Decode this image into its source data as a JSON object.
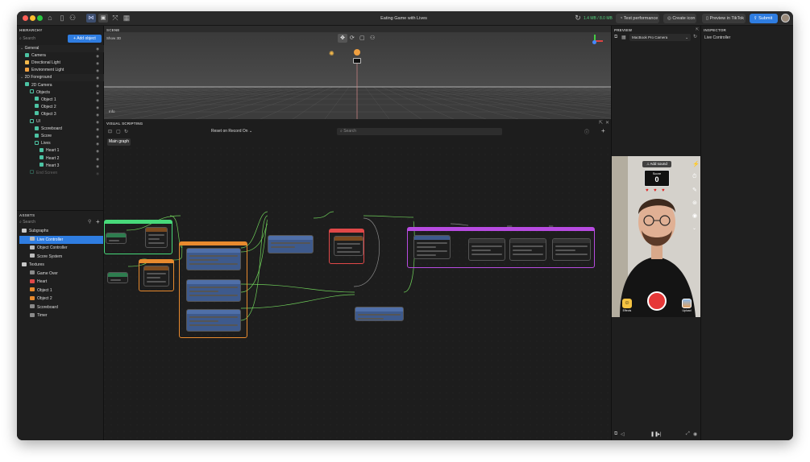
{
  "window": {
    "title": "Eating Game with Lives",
    "memory": "1.4 MB / 8.0 MB",
    "buttons": {
      "test": "Test performance",
      "icon": "Create icon",
      "preview": "Preview in TikTok",
      "submit": "Submit"
    }
  },
  "hierarchy": {
    "title": "HIERARCHY",
    "search_placeholder": "Search",
    "add_button": "+ Add object",
    "rows": [
      {
        "label": "General",
        "indent": 0,
        "section": true,
        "icon": "chevron-down-icon"
      },
      {
        "label": "Camera",
        "indent": 1,
        "icon": "camera-icon"
      },
      {
        "label": "Directional Light",
        "indent": 1,
        "icon": "light-icon"
      },
      {
        "label": "Environment Light",
        "indent": 1,
        "icon": "sun-icon"
      },
      {
        "label": "2D Foreground",
        "indent": 0,
        "section": true,
        "icon": "chevron-down-icon"
      },
      {
        "label": "2D Camera",
        "indent": 1,
        "icon": "camera-icon"
      },
      {
        "label": "Objects",
        "indent": 2,
        "icon": "group-icon"
      },
      {
        "label": "Object 1",
        "indent": 3,
        "icon": "image-icon"
      },
      {
        "label": "Object 2",
        "indent": 3,
        "icon": "image-icon"
      },
      {
        "label": "Object 3",
        "indent": 3,
        "icon": "image-icon"
      },
      {
        "label": "UI",
        "indent": 2,
        "icon": "group-icon"
      },
      {
        "label": "Scoreboard",
        "indent": 3,
        "icon": "image-icon"
      },
      {
        "label": "Score",
        "indent": 3,
        "icon": "text-icon"
      },
      {
        "label": "Lives",
        "indent": 3,
        "icon": "group-icon"
      },
      {
        "label": "Heart 1",
        "indent": 4,
        "icon": "image-icon"
      },
      {
        "label": "Heart 2",
        "indent": 4,
        "icon": "image-icon"
      },
      {
        "label": "Heart 3",
        "indent": 4,
        "icon": "image-icon"
      },
      {
        "label": "End Screen",
        "indent": 2,
        "icon": "group-icon",
        "dim": true
      }
    ]
  },
  "assets": {
    "title": "ASSETS",
    "search_placeholder": "Search",
    "rows": [
      {
        "label": "Subgraphs",
        "indent": 0,
        "icon": "folder-icon"
      },
      {
        "label": "Live Controller",
        "indent": 1,
        "icon": "subgraph-icon",
        "selected": true
      },
      {
        "label": "Object Controller",
        "indent": 1,
        "icon": "subgraph-icon"
      },
      {
        "label": "Score System",
        "indent": 1,
        "icon": "subgraph-icon"
      },
      {
        "label": "Textures",
        "indent": 0,
        "icon": "folder-icon"
      },
      {
        "label": "Game Over",
        "indent": 1,
        "icon": "texture-icon"
      },
      {
        "label": "Heart",
        "indent": 1,
        "icon": "heart-icon"
      },
      {
        "label": "Object 1",
        "indent": 1,
        "icon": "texture-icon"
      },
      {
        "label": "Object 2",
        "indent": 1,
        "icon": "texture-icon"
      },
      {
        "label": "Scoreboard",
        "indent": 1,
        "icon": "texture-icon"
      },
      {
        "label": "Timer",
        "indent": 1,
        "icon": "texture-icon"
      }
    ]
  },
  "scene": {
    "title": "SCENE",
    "show3d": "Show 3D",
    "info": "Info"
  },
  "visual_scripting": {
    "title": "VISUAL SCRIPTING",
    "reset_option": "Reset on Record On",
    "search_placeholder": "Search",
    "tab": "Main graph"
  },
  "preview": {
    "title": "PREVIEW",
    "device": "MacBook Pro Camera",
    "add_sound": "Add sound",
    "score_label": "Score",
    "score_value": "0",
    "lives": 3,
    "effects_label": "Effects",
    "upload_label": "Upload"
  },
  "inspector": {
    "title": "INSPECTOR",
    "selected": "Live Controller"
  },
  "colors": {
    "accent": "#2f7de1",
    "green": "#48d97a",
    "orange": "#e88a2e",
    "red": "#e04848",
    "purple": "#b74be0",
    "teal": "#4cc3a3"
  }
}
